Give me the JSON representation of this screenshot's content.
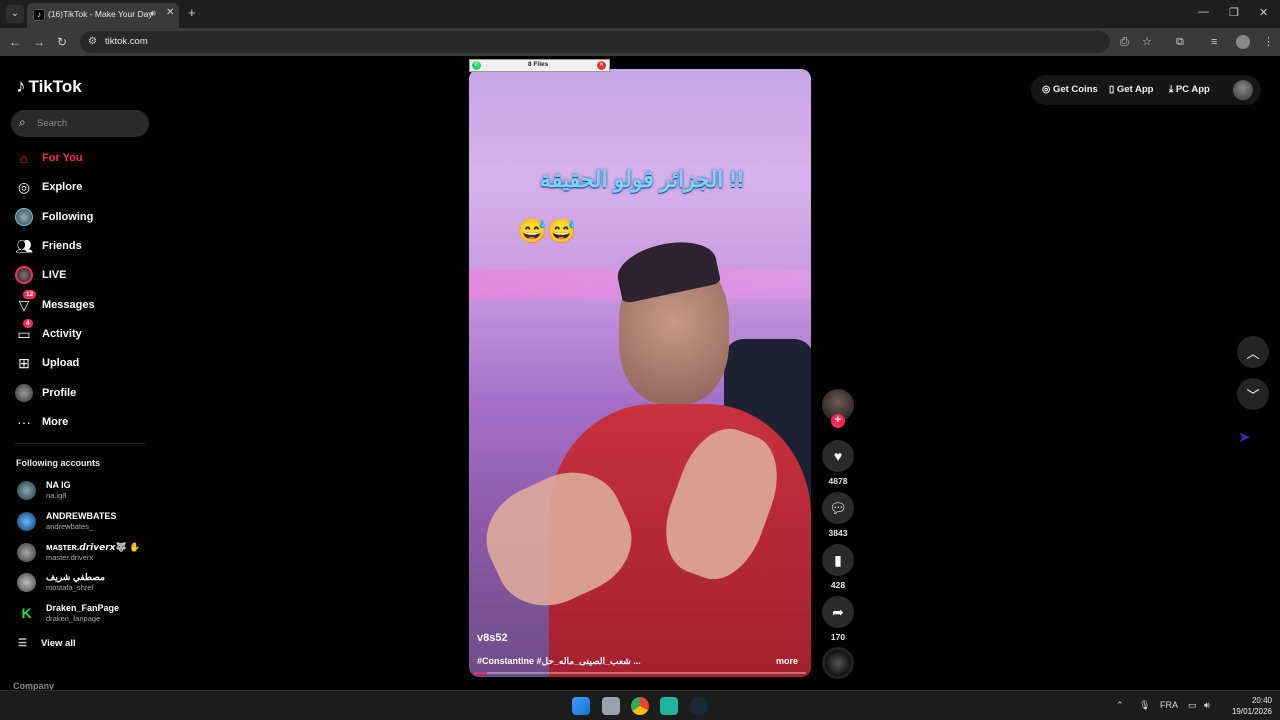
{
  "browser": {
    "tab_title": "(16)TikTok - Make Your Day",
    "url": "tiktok.com"
  },
  "sidebar": {
    "logo": "TikTok",
    "search_placeholder": "Search",
    "nav": [
      {
        "label": "For You",
        "icon": "home-icon",
        "active": true
      },
      {
        "label": "Explore",
        "icon": "compass-icon"
      },
      {
        "label": "Following",
        "icon": "following-avatar-icon"
      },
      {
        "label": "Friends",
        "icon": "friends-icon"
      },
      {
        "label": "LIVE",
        "icon": "live-icon"
      },
      {
        "label": "Messages",
        "icon": "messages-icon",
        "badge": "12"
      },
      {
        "label": "Activity",
        "icon": "activity-icon",
        "badge": "4"
      },
      {
        "label": "Upload",
        "icon": "upload-icon"
      },
      {
        "label": "Profile",
        "icon": "profile-icon"
      },
      {
        "label": "More",
        "icon": "more-icon"
      }
    ],
    "following_title": "Following accounts",
    "accounts": [
      {
        "name": "NA IG",
        "username": "na.ig8"
      },
      {
        "name": "ANDREWBATES",
        "username": "andrewbates_"
      },
      {
        "name": "ᴍᴀꜱᴛᴇʀ.𝙙𝙧𝙞𝙫𝙚𝙧𝙭🐺 ✋",
        "username": "master.driverx"
      },
      {
        "name": "مصطفي شريف",
        "username": "mostafa_shref"
      },
      {
        "name": "Draken_FanPage",
        "username": "draken_fanpage"
      }
    ],
    "view_all": "View all",
    "company": "Company"
  },
  "top_actions": {
    "get_coins": "Get Coins",
    "get_app": "Get App",
    "pc_app": "PC App"
  },
  "overlay": {
    "files_label": "8 Files"
  },
  "video": {
    "overlay_title": "!! الجزائر قولو الحقيقة",
    "emoji": "😅😅",
    "username": "v8s52",
    "caption": "#Constantine #شعب_الصينى_ماله_حل ...",
    "more": "more",
    "progress": 0.04
  },
  "actions": {
    "likes": "4878",
    "comments": "3843",
    "saves": "428",
    "shares": "170"
  },
  "taskbar": {
    "lang": "FRA",
    "time": "20:40",
    "date": "19/01/2026"
  },
  "colors": {
    "accent": "#fe2c55",
    "bg": "#000000"
  }
}
